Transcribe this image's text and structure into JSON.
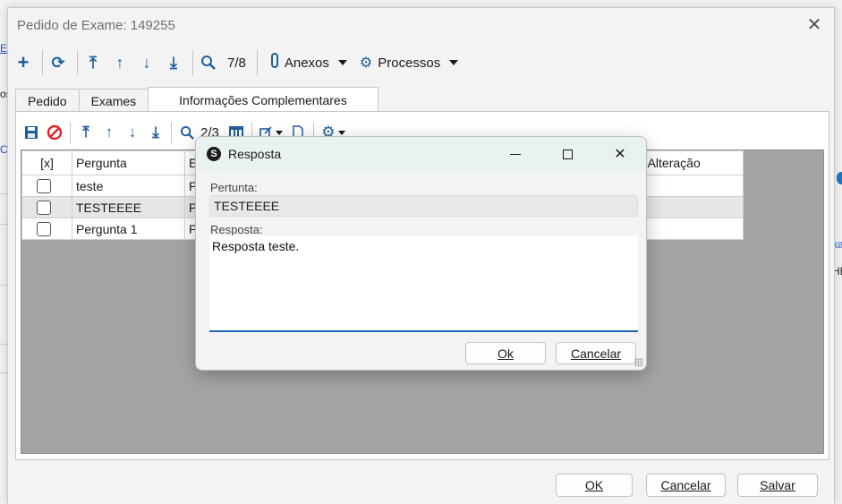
{
  "background": {
    "frag_link": "E",
    "frag_os": "os",
    "frag_c": "C",
    "frag_xa": "xa",
    "frag_he": "HE"
  },
  "window": {
    "title": "Pedido de Exame: 149255",
    "close_glyph": "✕"
  },
  "toolbar": {
    "record_counter": "7/8",
    "anexos_label": "Anexos",
    "processos_label": "Processos",
    "icons": [
      "plus-icon",
      "refresh-icon",
      "first-record-icon",
      "prev-record-icon",
      "next-record-icon",
      "last-record-icon",
      "search-icon",
      "paperclip-icon",
      "gear-icon"
    ]
  },
  "tabs": [
    {
      "label": "Pedido"
    },
    {
      "label": "Exames"
    },
    {
      "label": "Informações Complementares",
      "active": true
    }
  ],
  "inner_toolbar": {
    "record_counter": "2/3",
    "icons": [
      "save-icon",
      "cancel-icon",
      "first-icon",
      "up-icon",
      "down-icon",
      "last-icon",
      "search-icon",
      "columns-icon",
      "export-icon",
      "document-icon",
      "gear-icon"
    ]
  },
  "grid": {
    "columns": [
      "[x]",
      "Pergunta",
      "E",
      "ata Alteração"
    ],
    "rows": [
      {
        "pergunta": "teste",
        "e": "P",
        "checked": false
      },
      {
        "pergunta": "TESTEEEE",
        "e": "P",
        "checked": false,
        "selected": true
      },
      {
        "pergunta": "Pergunta 1",
        "e": "P",
        "checked": false
      }
    ]
  },
  "footer": {
    "ok_label": "OK",
    "cancel_label": "Cancelar",
    "save_label": "Salvar"
  },
  "dialog": {
    "title": "Resposta",
    "question_label": "Pertunta:",
    "question_value": "TESTEEEE",
    "answer_label": "Resposta:",
    "answer_value": "Resposta teste.",
    "ok_label": "Ok",
    "cancel_label": "Cancelar"
  },
  "colors": {
    "accent": "#1f5f9e",
    "danger": "#e0222b",
    "dialog_title_bg": "#e9f2ee",
    "focus_underline": "#1a66b8"
  }
}
